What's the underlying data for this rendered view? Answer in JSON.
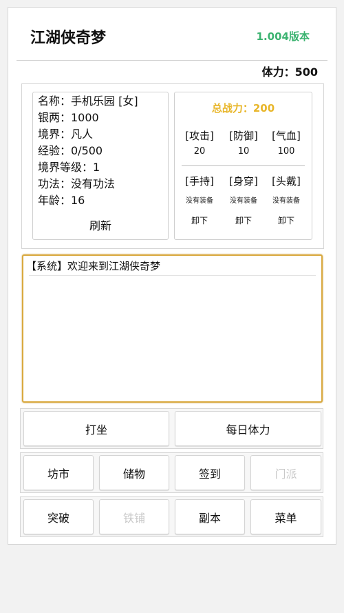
{
  "header": {
    "title": "江湖侠奇梦",
    "version": "1.004版本",
    "stamina": "体力：500"
  },
  "profile": {
    "name": "名称：手机乐园 [女]",
    "silver": "银两：1000",
    "realm": "境界：凡人",
    "exp": "经验：0/500",
    "realm_level": "境界等级：1",
    "skill": "功法：没有功法",
    "age": "年龄：16",
    "refresh_label": "刷新"
  },
  "power": {
    "total": "总战力：200",
    "stats": [
      {
        "label": "[攻击]",
        "value": "20"
      },
      {
        "label": "[防御]",
        "value": "10"
      },
      {
        "label": "[气血]",
        "value": "100"
      }
    ],
    "equipment": [
      {
        "label": "[手持]",
        "status": "没有装备",
        "action": "卸下"
      },
      {
        "label": "[身穿]",
        "status": "没有装备",
        "action": "卸下"
      },
      {
        "label": "[头戴]",
        "status": "没有装备",
        "action": "卸下"
      }
    ]
  },
  "log": {
    "first_line": "【系统】欢迎来到江湖侠奇梦"
  },
  "actions": {
    "row1": [
      "打坐",
      "每日体力"
    ],
    "row2": [
      "坊市",
      "储物",
      "签到",
      "门派"
    ],
    "row3": [
      "突破",
      "铁铺",
      "副本",
      "菜单"
    ]
  },
  "colors": {
    "version": "#3cb371",
    "total_power": "#e8b62a",
    "log_border": "#d9a93f",
    "disabled": "#c8c8c8"
  }
}
